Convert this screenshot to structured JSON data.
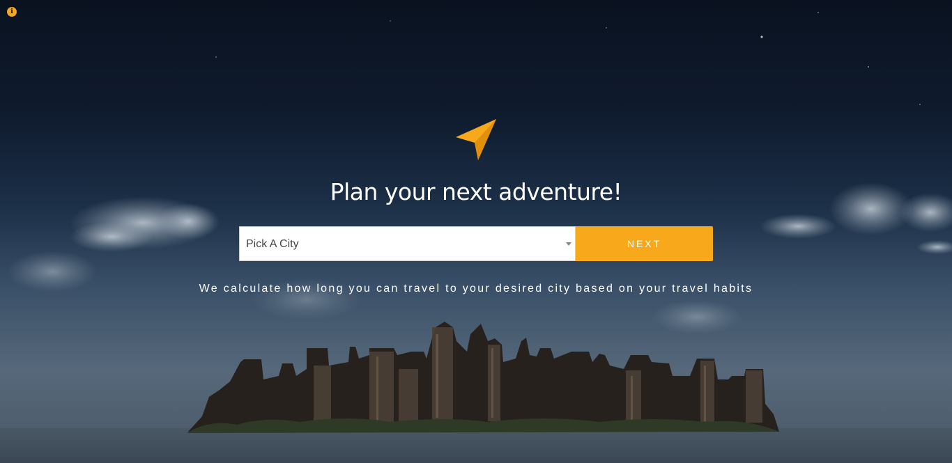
{
  "hero": {
    "headline": "Plan your next adventure!",
    "tagline": "We calculate how long you can travel to your desired city based on your travel habits"
  },
  "search": {
    "city_select_value": "Pick A City",
    "next_label": "NEXT"
  },
  "icons": {
    "info": "info-icon",
    "logo": "paper-plane-icon",
    "caret": "chevron-down-icon"
  },
  "colors": {
    "accent": "#f7a81b",
    "text_on_dark": "#ffffff",
    "select_background": "#ffffff"
  }
}
